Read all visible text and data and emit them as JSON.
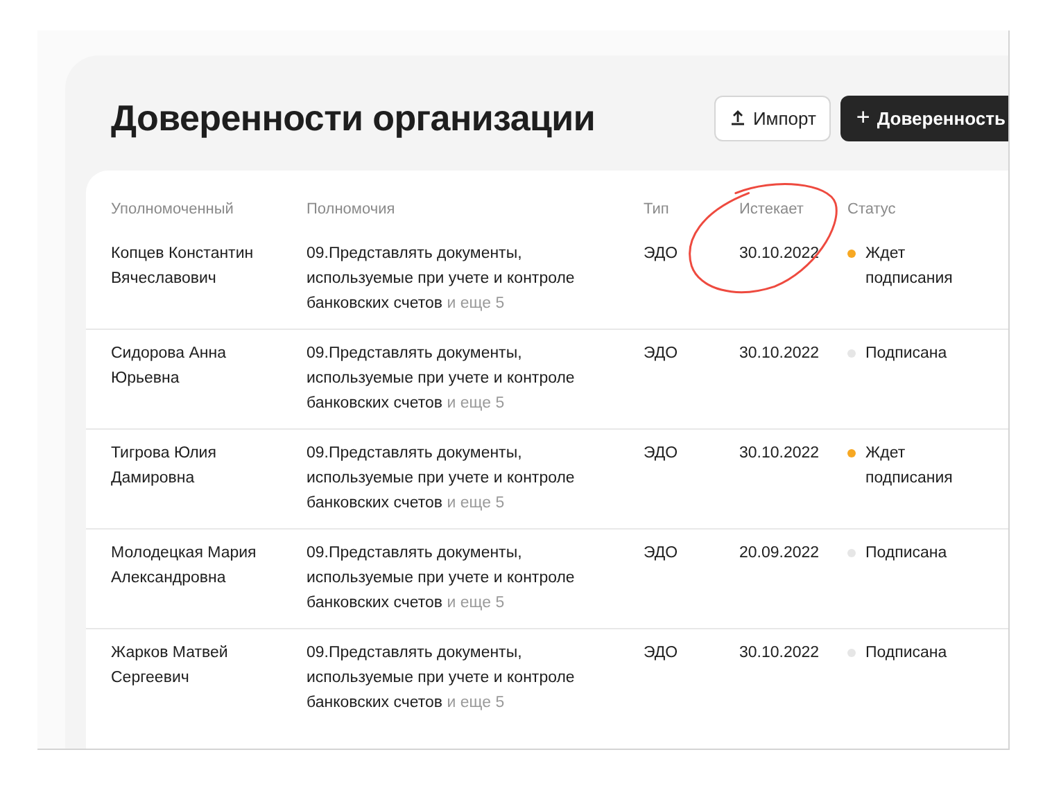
{
  "page": {
    "title": "Доверенности организации"
  },
  "buttons": [
    {
      "kind": "import",
      "label": "Импорт"
    },
    {
      "kind": "add",
      "label": "Доверенность",
      "icon": "+"
    }
  ],
  "table": {
    "columns": [
      "Уполномоченный",
      "Полномочия",
      "Тип",
      "Истекает",
      "Статус"
    ],
    "rows": [
      {
        "name": "Копцев Константин Вячеславович",
        "powers": "09.Представлять документы, используемые при учете и контроле банковских счетов",
        "more": "и еще 5",
        "type": "ЭДО",
        "expires": "30.10.2022",
        "status": "Ждет подписания",
        "color": "#f7a823"
      },
      {
        "name": "Сидорова Анна Юрьевна",
        "powers": "09.Представлять документы, используемые при учете и контроле банковских счетов",
        "more": "и еще 5",
        "type": "ЭДО",
        "expires": "30.10.2022",
        "status": "Подписана",
        "color": "#e6e6e6"
      },
      {
        "name": "Тигрова Юлия Дамировна",
        "powers": "09.Представлять документы, используемые при учете и контроле банковских счетов",
        "more": "и еще 5",
        "type": "ЭДО",
        "expires": "30.10.2022",
        "status": "Ждет подписания",
        "color": "#f7a823"
      },
      {
        "name": "Молодецкая Мария Александровна",
        "powers": "09.Представлять документы, используемые при учете и контроле банковских счетов",
        "more": "и еще 5",
        "type": "ЭДО",
        "expires": "20.09.2022",
        "status": "Подписана",
        "color": "#e6e6e6"
      },
      {
        "name": "Жарков Матвей Сергеевич",
        "powers": "09.Представлять документы, используемые при учете и контроле банковских счетов",
        "more": "и еще 5",
        "type": "ЭДО",
        "expires": "30.10.2022",
        "status": "Подписана",
        "color": "#e6e6e6"
      }
    ]
  }
}
